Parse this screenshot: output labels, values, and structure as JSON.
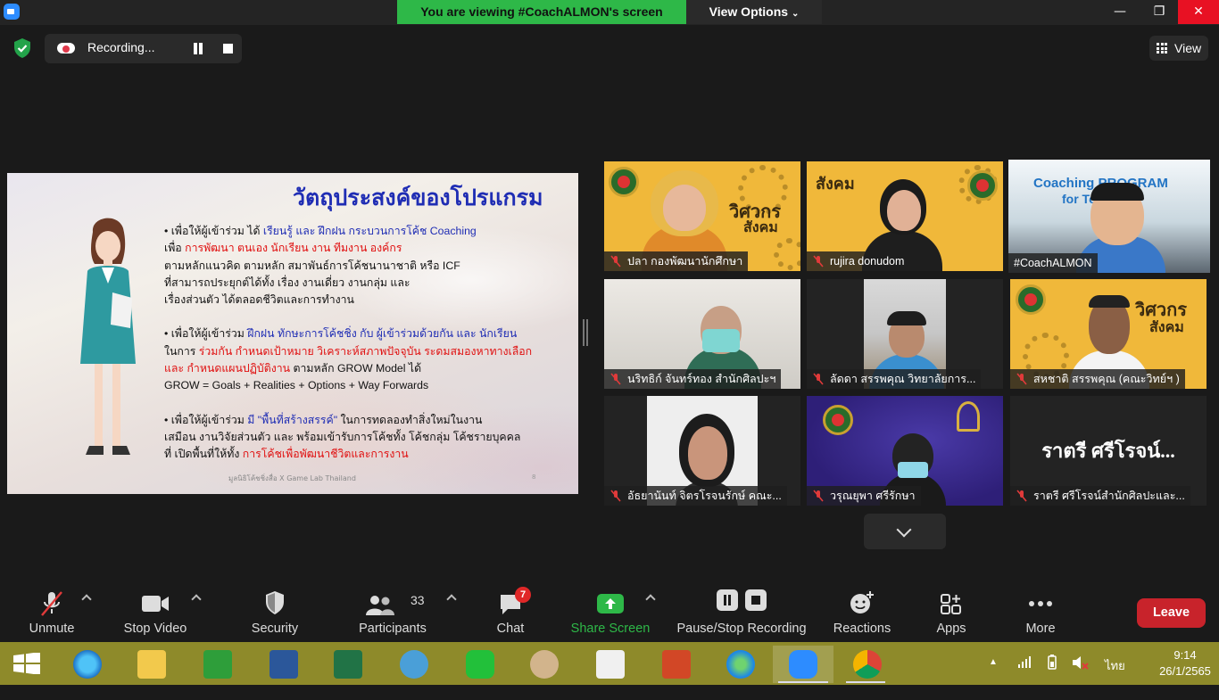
{
  "banner": {
    "viewing": "You are viewing #CoachALMON's screen",
    "view_options": "View Options"
  },
  "recording": {
    "label": "Recording..."
  },
  "view_button": "View",
  "slide": {
    "title": "วัตถุประสงค์ของโปรแกรม",
    "p1": [
      [
        {
          "t": "• เพื่อให้ผู้เข้าร่วม ได้ ",
          "c": ""
        },
        {
          "t": "เรียนรู้ และ ฝึกฝน กระบวนการโค้ช Coaching",
          "c": "blue"
        }
      ],
      [
        {
          "t": "เพื่อ ",
          "c": ""
        },
        {
          "t": "การพัฒนา ตนเอง นักเรียน งาน ทีมงาน องค์กร",
          "c": "red"
        }
      ],
      [
        {
          "t": "ตามหลักแนวคิด ตามหลัก สมาพันธ์การโค้ชนานาชาติ หรือ ICF",
          "c": ""
        }
      ],
      [
        {
          "t": "ที่สามารถประยุกต์ได้ทั้ง เรื่อง งานเดี่ยว งานกลุ่ม และ",
          "c": ""
        }
      ],
      [
        {
          "t": "เรื่องส่วนตัว ได้ตลอดชีวิตและการทำงาน",
          "c": ""
        }
      ]
    ],
    "p2": [
      [
        {
          "t": "• เพื่อให้ผู้เข้าร่วม ",
          "c": ""
        },
        {
          "t": "ฝึกฝน ทักษะการโค้ชชิ่ง กับ ผู้เข้าร่วมด้วยกัน และ นักเรียน",
          "c": "blue"
        }
      ],
      [
        {
          "t": "ในการ ",
          "c": ""
        },
        {
          "t": "ร่วมกัน กำหนดเป้าหมาย วิเคราะห์สภาพปัจจุบัน ระดมสมองหาทางเลือก",
          "c": "red"
        }
      ],
      [
        {
          "t": "และ กำหนดแผนปฏิบัติงาน ",
          "c": "red"
        },
        {
          "t": "ตามหลัก GROW Model ได้",
          "c": ""
        }
      ],
      [
        {
          "t": "GROW = Goals + Realities + Options + Way Forwards",
          "c": ""
        }
      ]
    ],
    "p3": [
      [
        {
          "t": "• เพื่อให้ผู้เข้าร่วม ",
          "c": ""
        },
        {
          "t": "มี \"พื้นที่สร้างสรรค์\"",
          "c": "blue"
        },
        {
          "t": " ในการทดลองทำสิ่งใหม่ในงาน",
          "c": ""
        }
      ],
      [
        {
          "t": "เสมือน งานวิจัยส่วนตัว และ พร้อมเข้ารับการโค้ชทั้ง โค้ชกลุ่ม โค้ชรายบุคคล",
          "c": ""
        }
      ],
      [
        {
          "t": "ที่ เปิดพื้นที่ให้ทั้ง ",
          "c": ""
        },
        {
          "t": "การโค้ชเพื่อพัฒนาชีวิตและการงาน",
          "c": "red"
        }
      ]
    ],
    "footer": "มูลนิธิโค้ชชิ่งสื่อ X Game Lab Thailand",
    "page": "8"
  },
  "participants": [
    {
      "name": "ปลา กองพัฒนานักศึกษา"
    },
    {
      "name": "rujira donudom"
    },
    {
      "name": "#CoachALMON"
    },
    {
      "name": "นริทธิก์ จันทร์ทอง สำนักศิลปะฯ"
    },
    {
      "name": "ลัดดา สรรพคุณ วิทยาลัยการ..."
    },
    {
      "name": "สหชาติ สรรพคุณ (คณะวิทย์ฯ )"
    },
    {
      "name": "อัธยานันท์ จิตรโรจนรักษ์ คณะ..."
    },
    {
      "name": "วรุณยุพา ศรีรักษา"
    },
    {
      "name": "ราตรี  ศรีโรจน์สำนักศิลปะและ..."
    }
  ],
  "tile_texts": {
    "banner_word1": "วิศวกร",
    "banner_word2": "สังคม",
    "coaching_banner": "Coaching PROGRAM",
    "coaching_banner2": "for Teacher",
    "ratree_big": "ราตรี   ศรีโรจน์..."
  },
  "toolbar": {
    "unmute": "Unmute",
    "stop_video": "Stop Video",
    "security": "Security",
    "participants": "Participants",
    "participants_count": "33",
    "chat": "Chat",
    "chat_badge": "7",
    "share_screen": "Share Screen",
    "pause_stop": "Pause/Stop Recording",
    "reactions": "Reactions",
    "apps": "Apps",
    "more": "More",
    "leave": "Leave"
  },
  "taskbar": {
    "language": "ไทย",
    "time": "9:14",
    "date": "26/1/2565"
  },
  "colors": {
    "share_green": "#2eb848",
    "leave_red": "#c8232b",
    "accent_blue": "#1f2db4"
  }
}
